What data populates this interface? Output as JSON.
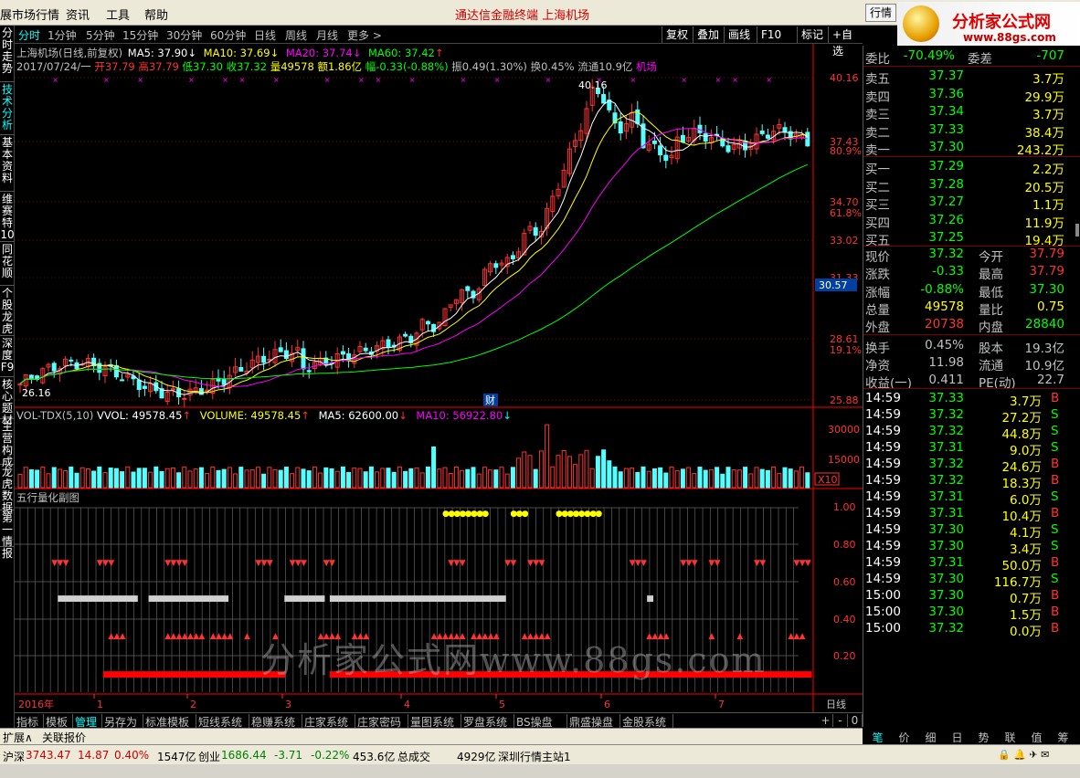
{
  "menu": {
    "app_title": "展市场行情",
    "items": [
      "资讯",
      "工具",
      "帮助"
    ],
    "center_title": "通达信金融终端   上海机场",
    "hq_button": "行情"
  },
  "logo": {
    "name": "分析家公式网",
    "url": "www.88gs.com"
  },
  "side_tabs": [
    "分时走势",
    "技术分析",
    "基本资料",
    "维赛特10",
    "同花顺",
    "个股龙虎",
    "深度F9",
    "核心题材",
    "主营构成",
    "龙虎数据",
    "第一情报"
  ],
  "period_tabs": [
    "分时",
    "1分钟",
    "5分钟",
    "15分钟",
    "30分钟",
    "60分钟",
    "日线",
    "周线",
    "月线",
    "更多 >"
  ],
  "tool_buttons": [
    "复权",
    "叠加",
    "画线",
    "F10",
    "标记",
    "+自选"
  ],
  "chart_header": {
    "title": "上海机场(日线,前复权)",
    "ma5": "MA5: 37.90",
    "ma10": "MA10: 37.69",
    "ma20": "MA20: 37.74",
    "ma60": "MA60: 37.42"
  },
  "price_bar": {
    "date": "2017/07/24/一",
    "open": "开37.79",
    "high": "高37.79",
    "low": "低37.30",
    "close": "收37.32",
    "vol": "量49578",
    "amount": "额1.86亿",
    "change": "幅-0.33(-0.88%)",
    "amp": "振0.49(1.30%)",
    "turnover": "换0.45%",
    "float": "流通10.9亿",
    "name": "机场"
  },
  "price_axis": [
    "40.16",
    "37.43",
    "80.9%",
    "34.70",
    "61.8%",
    "33.02",
    "31.33",
    "28.61",
    "19.1%",
    "25.88"
  ],
  "current_price_tag": "30.57",
  "annotations": {
    "high": "40.16",
    "low": "26.16",
    "cai": "财"
  },
  "vol_header": {
    "name": "VOL-TDX(5,10)",
    "vvol": "VVOL: 49578.45",
    "volume": "VOLUME: 49578.45",
    "ma5": "MA5: 62600.00",
    "ma10": "MA10: 56922.80"
  },
  "vol_axis": [
    "30000",
    "15000",
    "X10"
  ],
  "sub_title": "五行量化副图",
  "sub_axis": [
    "1.00",
    "0.80",
    "0.60",
    "0.40",
    "0.20"
  ],
  "watermark": "分析家公式网www.88gs.com",
  "time_axis": [
    "2016年",
    "1",
    "2",
    "3",
    "4",
    "5",
    "6",
    "7"
  ],
  "period_label": "日线",
  "bottom_tabs": [
    "指标",
    "模板",
    "管理",
    "另存为",
    "标准模板",
    "短线系统",
    "稳赚系统",
    "庄家系统",
    "庄家密码",
    "量图系统",
    "罗盘系统",
    "BS操盘",
    "鼎盛操盘",
    "金股系统"
  ],
  "scroll_buttons": [
    "+",
    "-",
    "0"
  ],
  "orderbook": {
    "weibi": {
      "label": "委比",
      "value": "-70.49%",
      "label2": "委差",
      "value2": "-707"
    },
    "sells": [
      [
        "卖五",
        "37.37",
        "3.7万"
      ],
      [
        "卖四",
        "37.36",
        "29.9万"
      ],
      [
        "卖三",
        "37.34",
        "3.7万"
      ],
      [
        "卖二",
        "37.33",
        "38.4万"
      ],
      [
        "卖一",
        "37.30",
        "243.2万"
      ]
    ],
    "buys": [
      [
        "买一",
        "37.29",
        "2.2万"
      ],
      [
        "买二",
        "37.28",
        "20.5万"
      ],
      [
        "买三",
        "37.27",
        "1.1万"
      ],
      [
        "买四",
        "37.26",
        "11.9万"
      ],
      [
        "买五",
        "37.25",
        "19.4万"
      ]
    ]
  },
  "stats": [
    [
      "现价",
      "37.32",
      "今开",
      "37.79"
    ],
    [
      "涨跌",
      "-0.33",
      "最高",
      "37.79"
    ],
    [
      "涨幅",
      "-0.88%",
      "最低",
      "37.30"
    ],
    [
      "总量",
      "49578",
      "量比",
      "0.75"
    ],
    [
      "外盘",
      "20738",
      "内盘",
      "28840"
    ],
    [
      "换手",
      "0.45%",
      "股本",
      "19.3亿"
    ],
    [
      "净资",
      "11.98",
      "流通",
      "10.9亿"
    ],
    [
      "收益(一)",
      "0.411",
      "PE(动)",
      "22.7"
    ]
  ],
  "ticks": [
    [
      "14:59",
      "37.33",
      "3.7万",
      "B"
    ],
    [
      "14:59",
      "37.32",
      "27.2万",
      "S"
    ],
    [
      "14:59",
      "37.32",
      "44.8万",
      "S"
    ],
    [
      "14:59",
      "37.31",
      "9.0万",
      "S"
    ],
    [
      "14:59",
      "37.32",
      "24.6万",
      "B"
    ],
    [
      "14:59",
      "37.32",
      "18.3万",
      "B"
    ],
    [
      "14:59",
      "37.31",
      "6.0万",
      "S"
    ],
    [
      "14:59",
      "37.31",
      "10.4万",
      "B"
    ],
    [
      "14:59",
      "37.30",
      "4.1万",
      "S"
    ],
    [
      "14:59",
      "37.30",
      "3.4万",
      "S"
    ],
    [
      "14:59",
      "37.31",
      "50.0万",
      "B"
    ],
    [
      "14:59",
      "37.30",
      "116.7万",
      "S"
    ],
    [
      "15:00",
      "37.30",
      "0.7万",
      "B"
    ],
    [
      "15:00",
      "37.30",
      "1.5万",
      "B"
    ],
    [
      "15:00",
      "37.32",
      "0.0万",
      "B"
    ]
  ],
  "right_tabs": [
    "笔",
    "价",
    "细",
    "日",
    "势",
    "联",
    "值",
    "筹"
  ],
  "expand": {
    "a": "扩展∧",
    "b": "关联报价"
  },
  "status": {
    "hs_label": "沪深",
    "hs_val": "3743.47",
    "hs_chg": "14.87",
    "hs_pct": "0.40%",
    "hs_amt": "1547亿",
    "cy_label": "创业",
    "cy_val": "1686.44",
    "cy_chg": "-3.71",
    "cy_pct": "-0.22%",
    "cy_amt": "453.6亿",
    "total_label": "总成交",
    "total_val": "4929亿",
    "server": "深圳行情主站1"
  },
  "colors": {
    "up": "#ff3232",
    "down": "#54ffff",
    "ma5": "#ffffff",
    "ma10": "#ffff00",
    "ma20": "#ff00ff",
    "ma60": "#00ff00"
  }
}
